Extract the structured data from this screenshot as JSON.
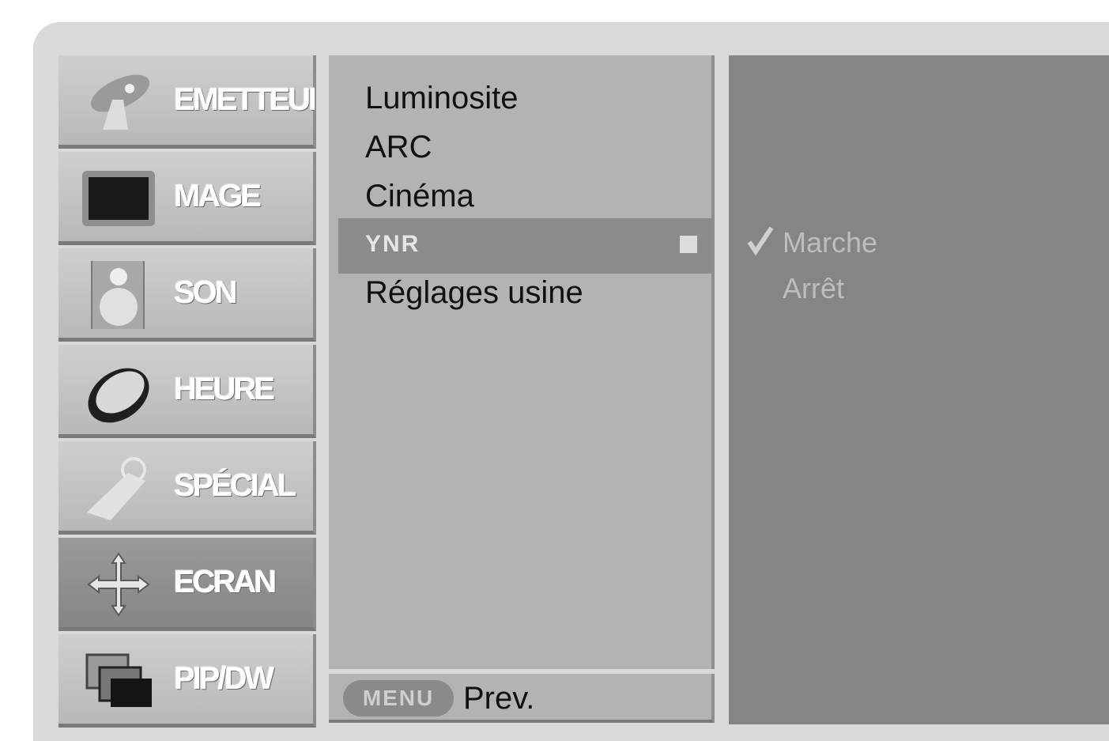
{
  "categories": [
    {
      "label": "EMETTEUR",
      "icon": "satellite-dish-icon"
    },
    {
      "label": "MAGE",
      "icon": "picture-screen-icon"
    },
    {
      "label": "SON",
      "icon": "speaker-icon"
    },
    {
      "label": "HEURE",
      "icon": "clock-icon"
    },
    {
      "label": "SPÉCIAL",
      "icon": "key-tag-icon"
    },
    {
      "label": "ECRAN",
      "icon": "move-arrows-icon",
      "active": true
    },
    {
      "label": "PIP/DW",
      "icon": "pip-windows-icon"
    }
  ],
  "menu": {
    "items": [
      "Luminosite",
      "ARC",
      "Cinéma",
      "YNR",
      "Réglages usine"
    ],
    "selected_label": "YNR",
    "footer_button": "MENU",
    "footer_label": "Prev."
  },
  "options": {
    "items": [
      "Marche",
      "Arrêt"
    ],
    "checked": "Marche"
  },
  "colors": {
    "frame": "#d9d9d9",
    "active_category": "#858585",
    "menu_bg": "#b3b3b3",
    "selection": "#8c8c8c",
    "options_bg": "#858585"
  }
}
